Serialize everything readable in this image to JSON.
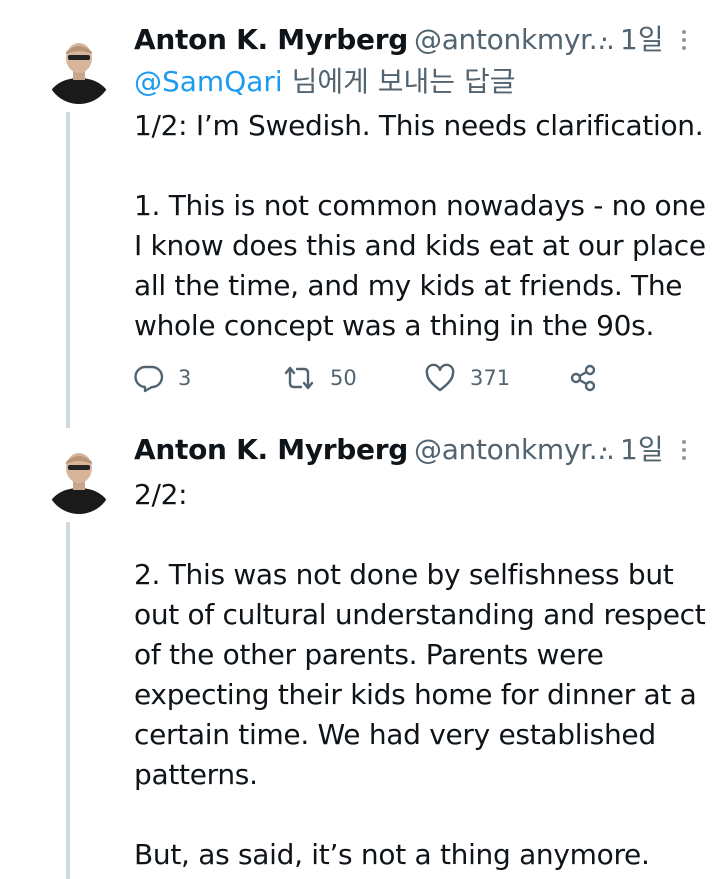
{
  "tweets": [
    {
      "author_name": "Anton K. Myrberg",
      "author_handle": "@antonkmyr...",
      "separator": "·",
      "time": "1일",
      "reply_to_handle": "@SamQari",
      "reply_to_suffix": " 님에게 보내는 답글",
      "text": "1/2: I’m Swedish. This needs clarification.\n\n1. This is not common nowadays - no one I know does this and kids eat at our place all the time, and my kids at friends. The whole concept was a thing in the 90s.",
      "replies": "3",
      "retweets": "50",
      "likes": "371"
    },
    {
      "author_name": "Anton K. Myrberg",
      "author_handle": "@antonkmyr...",
      "separator": "·",
      "time": "1일",
      "text": "2/2:\n\n2. This was not done by selfishness but out of cultural understanding and respect of the other parents. Parents were expecting their kids home for dinner at a certain time. We had very established patterns.\n\nBut, as said, it’s not a thing anymore."
    }
  ],
  "colors": {
    "text": "#0f1419",
    "secondary": "#536471",
    "link": "#1d9bf0",
    "thread_line": "#cfd9de"
  },
  "icons": [
    "avatar",
    "more-icon",
    "reply-icon",
    "retweet-icon",
    "like-icon",
    "share-icon"
  ]
}
